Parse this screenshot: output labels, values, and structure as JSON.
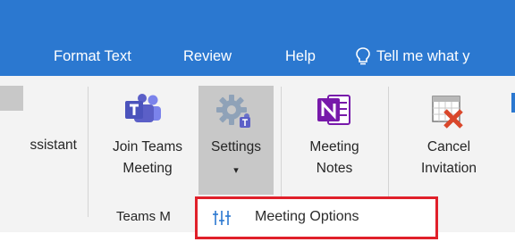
{
  "tabs": {
    "format_text": "Format Text",
    "review": "Review",
    "help": "Help",
    "tell_me": "Tell me what y"
  },
  "ribbon": {
    "assistant_label": "ssistant",
    "join_teams": {
      "line1": "Join Teams",
      "line2": "Meeting"
    },
    "settings": {
      "line1": "Settings",
      "caret": "▾"
    },
    "meeting_notes": {
      "line1": "Meeting",
      "line2": "Notes"
    },
    "cancel": {
      "line1": "Cancel",
      "line2": "Invitation"
    },
    "group_label": "Teams M"
  },
  "dropdown": {
    "meeting_options_label": "Meeting Options"
  },
  "colors": {
    "accent": "#2b78d0",
    "ribbon_bg": "#f3f3f3",
    "highlight": "#c8c8c8",
    "teams_purple": "#5b5fc7",
    "onenote_purple": "#7719aa",
    "annotation_red": "#e0202a"
  },
  "icons": {
    "tell_me": "lightbulb-icon",
    "teams": "teams-icon",
    "settings": "gear-teams-icon",
    "onenote": "onenote-icon",
    "cancel": "calendar-cancel-icon",
    "options": "sliders-icon"
  }
}
